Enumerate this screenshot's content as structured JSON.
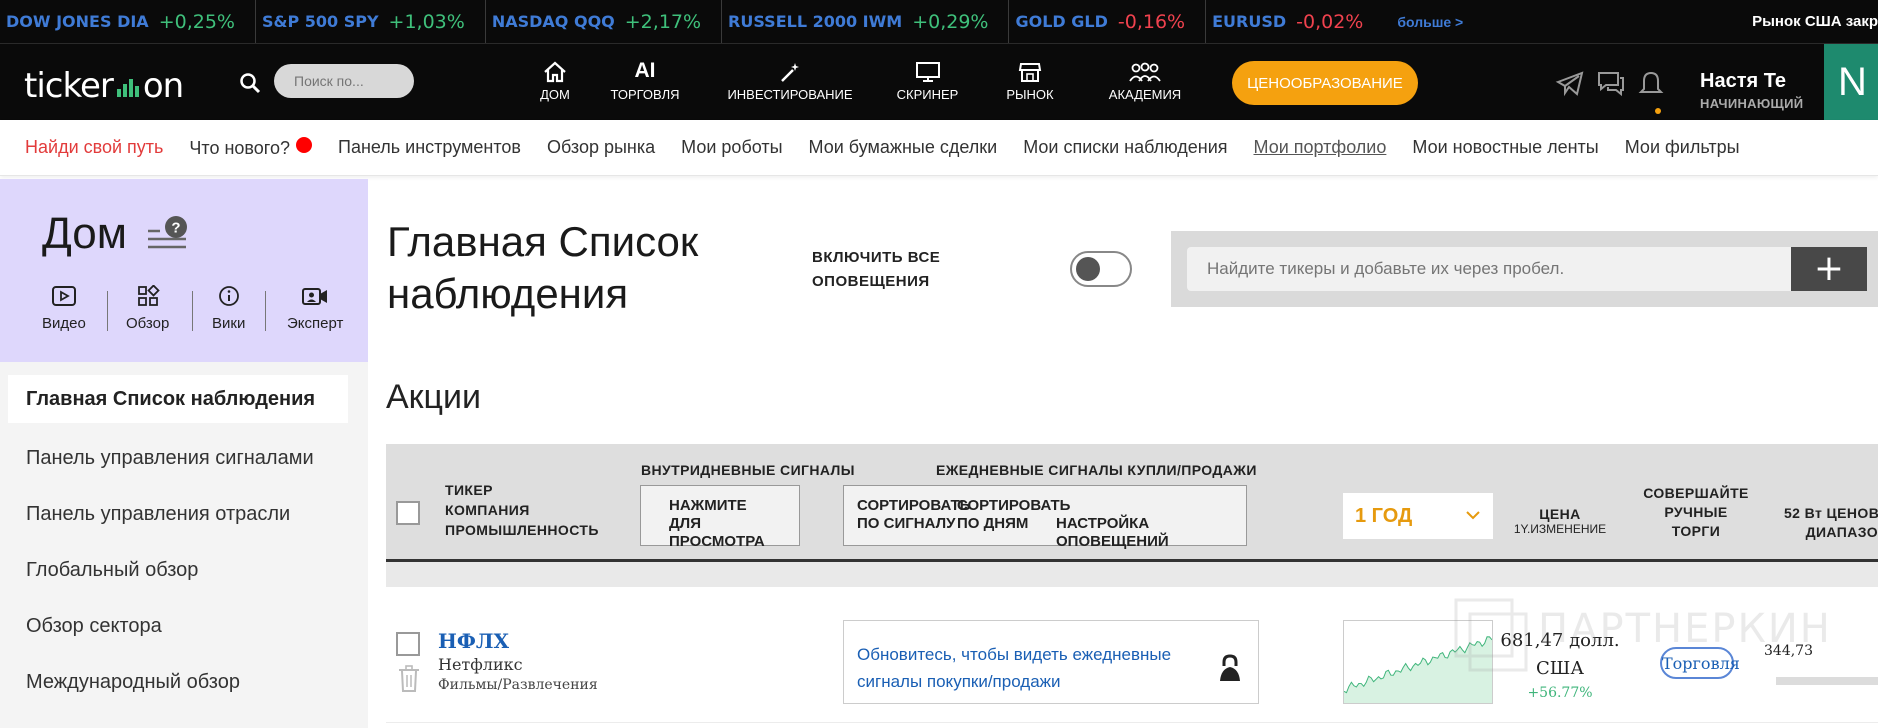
{
  "ticker_strip": {
    "items": [
      {
        "name": "DOW JONES DIA",
        "change": "+0,25%",
        "direction": "up"
      },
      {
        "name": "S&P 500 SPY",
        "change": "+1,03%",
        "direction": "up"
      },
      {
        "name": "NASDAQ QQQ",
        "change": "+2,17%",
        "direction": "up"
      },
      {
        "name": "RUSSELL 2000 IWM",
        "change": "+0,29%",
        "direction": "up"
      },
      {
        "name": "GOLD GLD",
        "change": "-0,16%",
        "direction": "down"
      },
      {
        "name": "EURUSD",
        "change": "-0,02%",
        "direction": "down"
      }
    ],
    "more_label": "больше >",
    "market_status": "Рынок США закр"
  },
  "nav": {
    "logo_text_left": "ticker",
    "logo_text_right": "on",
    "search_placeholder": "Поиск по...",
    "items": [
      {
        "label": "ДОМ",
        "icon": "home-icon"
      },
      {
        "label": "ТОРГОВЛЯ",
        "icon": "ai-icon",
        "glyph": "AI"
      },
      {
        "label": "ИНВЕСТИРОВАНИЕ",
        "icon": "magic-wand-icon"
      },
      {
        "label": "СКРИНЕР",
        "icon": "monitor-icon"
      },
      {
        "label": "РЫНОК",
        "icon": "store-icon"
      },
      {
        "label": "АКАДЕМИЯ",
        "icon": "group-icon"
      }
    ],
    "pricing_label": "ЦЕНООБРАЗОВАНИЕ",
    "user_name": "Настя Те",
    "user_level": "НАЧИНАЮЩИЙ",
    "avatar_letter": "N"
  },
  "subnav": {
    "items": [
      {
        "label": "Найди свой путь"
      },
      {
        "label": "Что нового?"
      },
      {
        "label": "Панель инструментов"
      },
      {
        "label": "Обзор рынка"
      },
      {
        "label": "Мои роботы"
      },
      {
        "label": "Мои бумажные сделки"
      },
      {
        "label": "Мои списки наблюдения"
      },
      {
        "label": "Мои портфолио"
      },
      {
        "label": "Мои новостные ленты"
      },
      {
        "label": "Мои фильтры"
      }
    ]
  },
  "sidebar": {
    "title": "Дом",
    "quick_links": [
      {
        "label": "Видео",
        "icon": "video-icon"
      },
      {
        "label": "Обзор",
        "icon": "grid-icon"
      },
      {
        "label": "Вики",
        "icon": "info-icon"
      },
      {
        "label": "Эксперт",
        "icon": "expert-camera-icon"
      }
    ],
    "items": [
      {
        "label": "Главная Список наблюдения"
      },
      {
        "label": "Панель управления сигналами"
      },
      {
        "label": "Панель управления отрасли"
      },
      {
        "label": "Глобальный обзор"
      },
      {
        "label": "Обзор сектора"
      },
      {
        "label": "Международный обзор"
      }
    ]
  },
  "main": {
    "title": "Главная Список наблюдения",
    "alerts_label": "ВКЛЮЧИТЬ ВСЕ ОПОВЕЩЕНИЯ",
    "alerts_enabled": false,
    "ticker_search_placeholder": "Найдите тикеры и добавьте их через пробел.",
    "add_label": "+",
    "section_title": "Акции",
    "table_head": {
      "col_ticker": [
        "ТИКЕР",
        "КОМПАНИЯ",
        "ПРОМЫШЛЕННОСТЬ"
      ],
      "intraday_label": "ВНУТРИДНЕВНЫЕ СИГНАЛЫ",
      "intraday_button": [
        "НАЖМИТЕ",
        "ДЛЯ ПРОСМОТРА"
      ],
      "daily_label": "ЕЖЕДНЕВНЫЕ СИГНАЛЫ КУПЛИ/ПРОДАЖИ",
      "sort_signal": [
        "СОРТИРОВАТЬ",
        "ПО СИГНАЛУ"
      ],
      "sort_days": [
        "СОРТИРОВАТЬ",
        "ПО ДНЯМ"
      ],
      "alert_settings": "НАСТРОЙКА ОПОВЕЩЕНИЙ",
      "period": "1 ГОД",
      "price": "ЦЕНА",
      "price_sub": "1Y.ИЗМЕНЕНИЕ",
      "manual_trades": [
        "СОВЕРШАЙТЕ",
        "РУЧНЫЕ",
        "ТОРГИ"
      ],
      "range_52w": [
        "52 Вт ЦЕНОВ",
        "ДИАПАЗО"
      ]
    },
    "rows": [
      {
        "ticker": "НФЛХ",
        "company": "Нетфликс",
        "industry": "Фильмы/Развлечения",
        "upsell": "Обновитесь, чтобы видеть ежедневные сигналы покупки/продажи",
        "price": "681,47 долл.",
        "currency": "США",
        "change": "+56.77%",
        "trade_label": "Торговля",
        "low_52w": "344,73"
      }
    ]
  },
  "watermark_text": "ПАРТНЕРКИН",
  "colors": {
    "accent_orange": "#f5a10f",
    "up_green": "#3fc07b",
    "down_red": "#f0424e",
    "link_blue": "#1a5fb4",
    "sidebar_lavender": "#ded7fc",
    "avatar_green": "#1e8a6e"
  }
}
